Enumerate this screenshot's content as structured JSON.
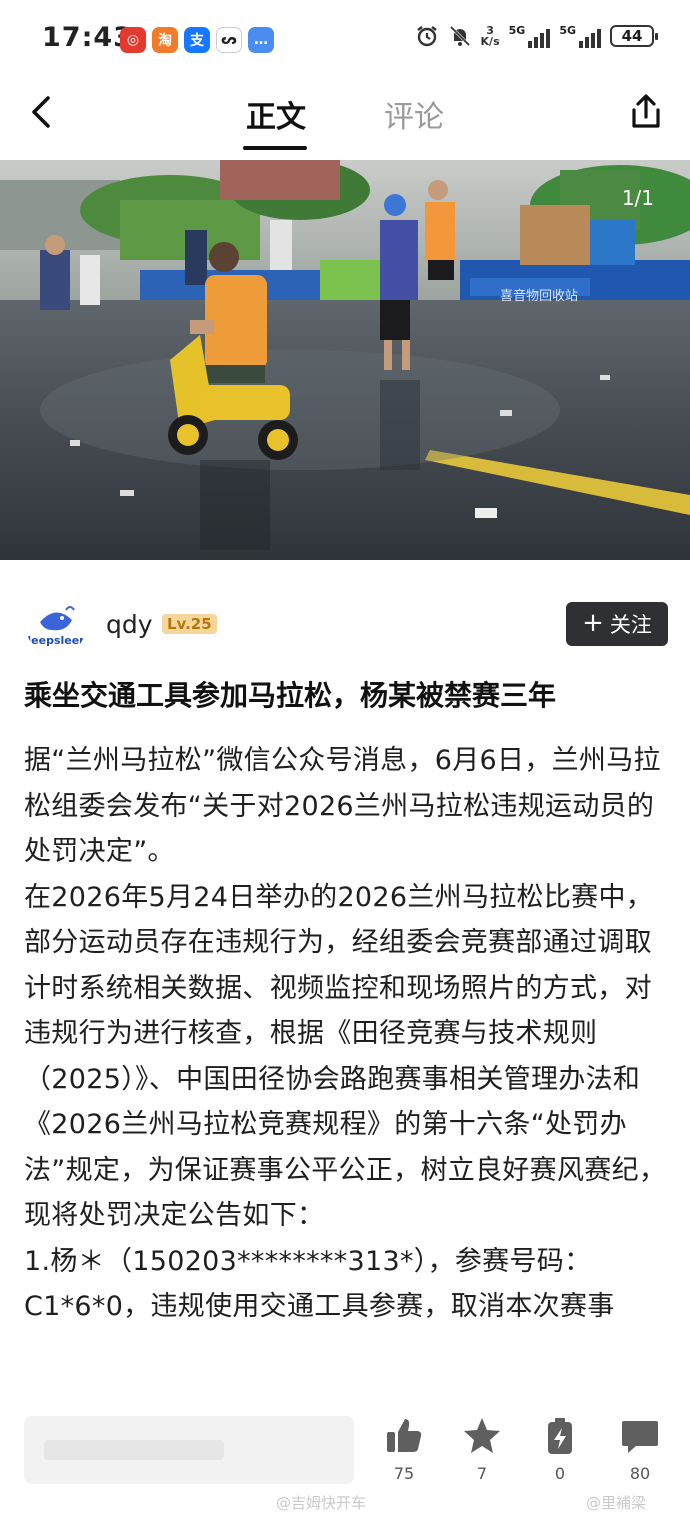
{
  "status_bar": {
    "time": "17:43",
    "app_icons": [
      {
        "name": "app-icon-red",
        "glyph": "◎",
        "color": "#e23a2e"
      },
      {
        "name": "app-icon-orange",
        "glyph": "淘",
        "color": "#f27a2b"
      },
      {
        "name": "app-icon-alipay",
        "glyph": "支",
        "color": "#1677ff"
      },
      {
        "name": "app-icon-white",
        "glyph": "ᔕ",
        "color": "#ffffff"
      },
      {
        "name": "app-icon-message",
        "glyph": "…",
        "color": "#4a8cf0"
      }
    ],
    "net_speed_value": "3",
    "net_speed_unit": "K/s",
    "signal_label_1": "5G",
    "signal_label_2": "5G",
    "battery": "44"
  },
  "nav": {
    "tab_main": "正文",
    "tab_comments": "评论"
  },
  "photo": {
    "counter": "1/1",
    "banner_text": "喜音物回收站"
  },
  "author": {
    "avatar_text": "leepsleer",
    "name": "qdy",
    "level": "Lv.25",
    "follow_label": "关注"
  },
  "article": {
    "headline": "乘坐交通工具参加马拉松，杨某被禁赛三年",
    "paragraphs": [
      "据“兰州马拉松”微信公众号消息，6月6日，兰州马拉松组委会发布“关于对2026兰州马拉松违规运动员的处罚决定”。",
      "在2026年5月24日举办的2026兰州马拉松比赛中，部分运动员存在违规行为，经组委会竞赛部通过调取计时系统相关数据、视频监控和现场照片的方式，对违规行为进行核查，根据《田径竞赛与技术规则（2025）》、中国田径协会路跑赛事相关管理办法和《2026兰州马拉松竞赛规程》的第十六条“处罚办法”规定，为保证赛事公平公正，树立良好赛风赛纪，现将处罚决定公告如下：",
      "1.杨＊（150203********313*），参赛号码：C1*6*0，违规使用交通工具参赛，取消本次赛事"
    ]
  },
  "bottom": {
    "likes": "75",
    "favorites": "7",
    "shares": "0",
    "comments": "80",
    "watermark_left": "@吉姆快开车",
    "watermark_right": "@里補梁"
  }
}
